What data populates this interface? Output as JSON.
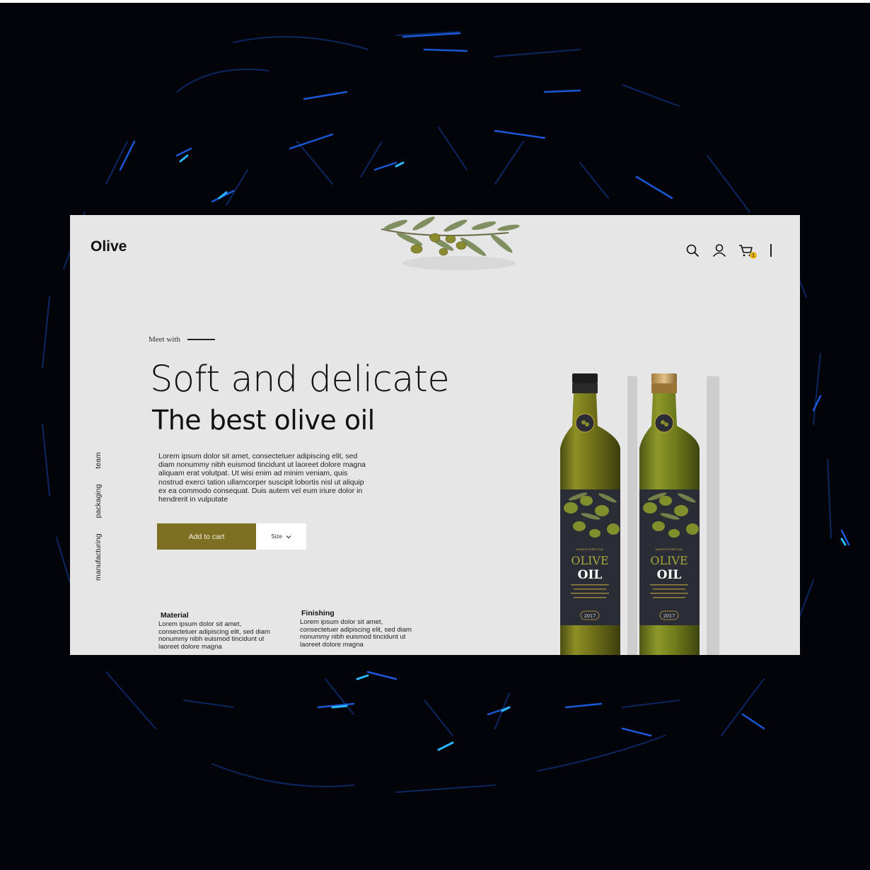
{
  "brand": {
    "logo": "Olive"
  },
  "header": {
    "icons": [
      "search-icon",
      "user-icon",
      "cart-icon"
    ],
    "cart_count": "1"
  },
  "hero": {
    "eyebrow": "Meet with",
    "headline": "Soft and delicate",
    "subheadline": "The best olive oil",
    "description": "Lorem ipsum dolor sit amet, consectetuer adipiscing elit, sed diam nonummy nibh euismod tincidunt ut laoreet dolore magna aliquam erat volutpat. Ut wisi enim ad minim veniam, quis nostrud exerci tation ullamcorper suscipit lobortis nisl ut aliquip ex ea commodo consequat. Duis autem vel eum iriure dolor in hendrerit in vulputate"
  },
  "side_nav": {
    "items": [
      "manufacturing",
      "packaging",
      "team"
    ]
  },
  "actions": {
    "add_to_cart_label": "Add to cart",
    "size_label": "Size"
  },
  "features": [
    {
      "title": "Material",
      "text": "Lorem ipsum dolor sit amet, consectetuer adipiscing elit, sed diam nonummy nibh euismod tincidunt ut laoreet dolore magna"
    },
    {
      "title": "Finishing",
      "text": "Lorem ipsum dolor sit amet, consectetuer adipiscing elit, sed diam nonummy nibh euismod tincidunt ut laoreet dolore magna"
    }
  ],
  "product": {
    "label_line1": "OLIVE",
    "label_line2": "OIL",
    "label_top": "MADE IN PORTUGAL",
    "label_year": "2017"
  },
  "colors": {
    "accent": "#7e7023",
    "page_background": "#e6e6e6",
    "outer_background": "#03040a",
    "badge": "#e8b518",
    "label_dark": "#2a2d35",
    "label_gold": "#c9a640"
  }
}
